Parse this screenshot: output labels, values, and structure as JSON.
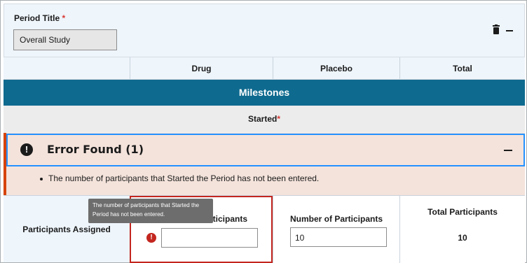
{
  "period": {
    "title_label": "Period Title",
    "required_mark": "*",
    "title_value": "Overall Study"
  },
  "arms": [
    "Drug",
    "Placebo",
    "Total"
  ],
  "milestones_label": "Milestones",
  "started": {
    "label": "Started",
    "required_mark": "*"
  },
  "error": {
    "title": "Error Found (1)",
    "icon_glyph": "!",
    "messages": [
      "The number of participants that Started the Period has not been entered."
    ]
  },
  "participants": {
    "row_label": "Participants Assigned",
    "drug_header": "Number of Participants",
    "drug_value": "",
    "placebo_header": "Number of Participants",
    "placebo_value": "10",
    "total_header": "Total Participants",
    "total_value": "10"
  },
  "tooltip": "The number of participants that Started the Period has not been entered.",
  "icons": {
    "delete": "trash-icon",
    "collapse": "minus-icon",
    "error": "exclamation-icon"
  },
  "colors": {
    "milestones_band": "#0f6a8f",
    "error_background": "#f4e3db",
    "error_stripe": "#d54309",
    "focus_outline": "#2491ff",
    "field_error": "#c3261f"
  }
}
